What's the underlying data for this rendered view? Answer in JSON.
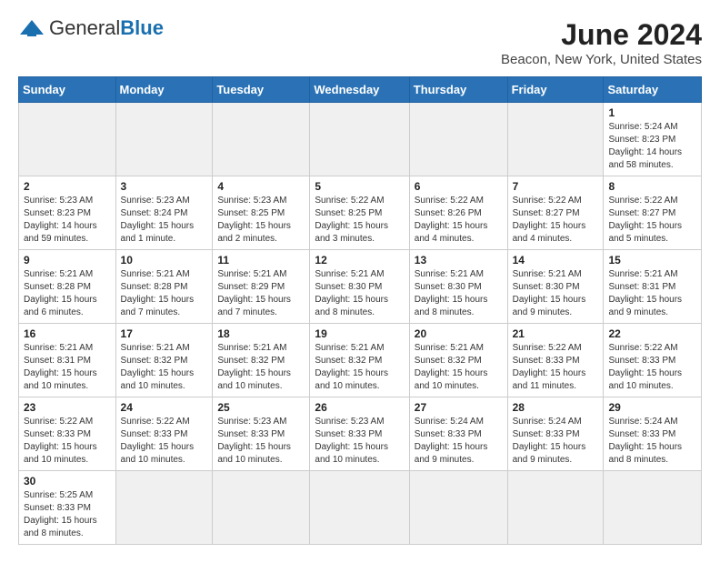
{
  "header": {
    "logo": {
      "general": "General",
      "blue": "Blue"
    },
    "title": "June 2024",
    "location": "Beacon, New York, United States"
  },
  "weekdays": [
    "Sunday",
    "Monday",
    "Tuesday",
    "Wednesday",
    "Thursday",
    "Friday",
    "Saturday"
  ],
  "weeks": [
    [
      {
        "day": "",
        "info": ""
      },
      {
        "day": "",
        "info": ""
      },
      {
        "day": "",
        "info": ""
      },
      {
        "day": "",
        "info": ""
      },
      {
        "day": "",
        "info": ""
      },
      {
        "day": "",
        "info": ""
      },
      {
        "day": "1",
        "info": "Sunrise: 5:24 AM\nSunset: 8:23 PM\nDaylight: 14 hours\nand 58 minutes."
      }
    ],
    [
      {
        "day": "2",
        "info": "Sunrise: 5:23 AM\nSunset: 8:23 PM\nDaylight: 14 hours\nand 59 minutes."
      },
      {
        "day": "3",
        "info": "Sunrise: 5:23 AM\nSunset: 8:24 PM\nDaylight: 15 hours\nand 1 minute."
      },
      {
        "day": "4",
        "info": "Sunrise: 5:23 AM\nSunset: 8:25 PM\nDaylight: 15 hours\nand 2 minutes."
      },
      {
        "day": "5",
        "info": "Sunrise: 5:22 AM\nSunset: 8:25 PM\nDaylight: 15 hours\nand 3 minutes."
      },
      {
        "day": "6",
        "info": "Sunrise: 5:22 AM\nSunset: 8:26 PM\nDaylight: 15 hours\nand 4 minutes."
      },
      {
        "day": "7",
        "info": "Sunrise: 5:22 AM\nSunset: 8:27 PM\nDaylight: 15 hours\nand 4 minutes."
      },
      {
        "day": "8",
        "info": "Sunrise: 5:22 AM\nSunset: 8:27 PM\nDaylight: 15 hours\nand 5 minutes."
      }
    ],
    [
      {
        "day": "9",
        "info": "Sunrise: 5:21 AM\nSunset: 8:28 PM\nDaylight: 15 hours\nand 6 minutes."
      },
      {
        "day": "10",
        "info": "Sunrise: 5:21 AM\nSunset: 8:28 PM\nDaylight: 15 hours\nand 7 minutes."
      },
      {
        "day": "11",
        "info": "Sunrise: 5:21 AM\nSunset: 8:29 PM\nDaylight: 15 hours\nand 7 minutes."
      },
      {
        "day": "12",
        "info": "Sunrise: 5:21 AM\nSunset: 8:30 PM\nDaylight: 15 hours\nand 8 minutes."
      },
      {
        "day": "13",
        "info": "Sunrise: 5:21 AM\nSunset: 8:30 PM\nDaylight: 15 hours\nand 8 minutes."
      },
      {
        "day": "14",
        "info": "Sunrise: 5:21 AM\nSunset: 8:30 PM\nDaylight: 15 hours\nand 9 minutes."
      },
      {
        "day": "15",
        "info": "Sunrise: 5:21 AM\nSunset: 8:31 PM\nDaylight: 15 hours\nand 9 minutes."
      }
    ],
    [
      {
        "day": "16",
        "info": "Sunrise: 5:21 AM\nSunset: 8:31 PM\nDaylight: 15 hours\nand 10 minutes."
      },
      {
        "day": "17",
        "info": "Sunrise: 5:21 AM\nSunset: 8:32 PM\nDaylight: 15 hours\nand 10 minutes."
      },
      {
        "day": "18",
        "info": "Sunrise: 5:21 AM\nSunset: 8:32 PM\nDaylight: 15 hours\nand 10 minutes."
      },
      {
        "day": "19",
        "info": "Sunrise: 5:21 AM\nSunset: 8:32 PM\nDaylight: 15 hours\nand 10 minutes."
      },
      {
        "day": "20",
        "info": "Sunrise: 5:21 AM\nSunset: 8:32 PM\nDaylight: 15 hours\nand 10 minutes."
      },
      {
        "day": "21",
        "info": "Sunrise: 5:22 AM\nSunset: 8:33 PM\nDaylight: 15 hours\nand 11 minutes."
      },
      {
        "day": "22",
        "info": "Sunrise: 5:22 AM\nSunset: 8:33 PM\nDaylight: 15 hours\nand 10 minutes."
      }
    ],
    [
      {
        "day": "23",
        "info": "Sunrise: 5:22 AM\nSunset: 8:33 PM\nDaylight: 15 hours\nand 10 minutes."
      },
      {
        "day": "24",
        "info": "Sunrise: 5:22 AM\nSunset: 8:33 PM\nDaylight: 15 hours\nand 10 minutes."
      },
      {
        "day": "25",
        "info": "Sunrise: 5:23 AM\nSunset: 8:33 PM\nDaylight: 15 hours\nand 10 minutes."
      },
      {
        "day": "26",
        "info": "Sunrise: 5:23 AM\nSunset: 8:33 PM\nDaylight: 15 hours\nand 10 minutes."
      },
      {
        "day": "27",
        "info": "Sunrise: 5:24 AM\nSunset: 8:33 PM\nDaylight: 15 hours\nand 9 minutes."
      },
      {
        "day": "28",
        "info": "Sunrise: 5:24 AM\nSunset: 8:33 PM\nDaylight: 15 hours\nand 9 minutes."
      },
      {
        "day": "29",
        "info": "Sunrise: 5:24 AM\nSunset: 8:33 PM\nDaylight: 15 hours\nand 8 minutes."
      }
    ],
    [
      {
        "day": "30",
        "info": "Sunrise: 5:25 AM\nSunset: 8:33 PM\nDaylight: 15 hours\nand 8 minutes."
      },
      {
        "day": "",
        "info": ""
      },
      {
        "day": "",
        "info": ""
      },
      {
        "day": "",
        "info": ""
      },
      {
        "day": "",
        "info": ""
      },
      {
        "day": "",
        "info": ""
      },
      {
        "day": "",
        "info": ""
      }
    ]
  ]
}
